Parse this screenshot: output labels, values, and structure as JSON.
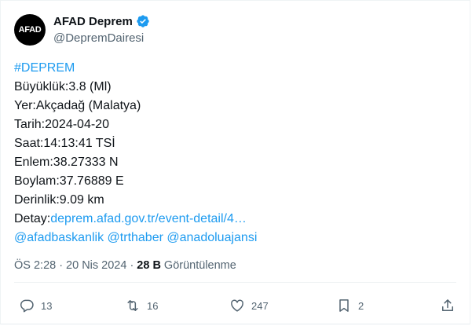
{
  "author": {
    "avatar_text": "AFAD",
    "display_name": "AFAD Deprem",
    "handle": "@DepremDairesi"
  },
  "tweet": {
    "hashtag": "#DEPREM",
    "lines": [
      "Büyüklük:3.8 (Ml)",
      "Yer:Akçadağ (Malatya)",
      "Tarih:2024-04-20",
      "Saat:14:13:41 TSİ",
      "Enlem:38.27333 N",
      "Boylam:37.76889 E",
      "Derinlik:9.09 km"
    ],
    "detail_label": "Detay:",
    "detail_link": "deprem.afad.gov.tr/event-detail/4…",
    "mentions": [
      "@afadbaskanlik",
      "@trthaber",
      "@anadoluajansi"
    ]
  },
  "meta": {
    "time": "ÖS 2:28",
    "separator": "·",
    "date": "20 Nis 2024",
    "views_count": "28 B",
    "views_label": "Görüntülenme"
  },
  "actions": {
    "replies": "13",
    "retweets": "16",
    "likes": "247",
    "bookmarks": "2"
  },
  "colors": {
    "link": "#1d9bf0",
    "secondary_text": "#536471",
    "primary_text": "#0f1419",
    "verified_badge": "#1d9bf0"
  }
}
